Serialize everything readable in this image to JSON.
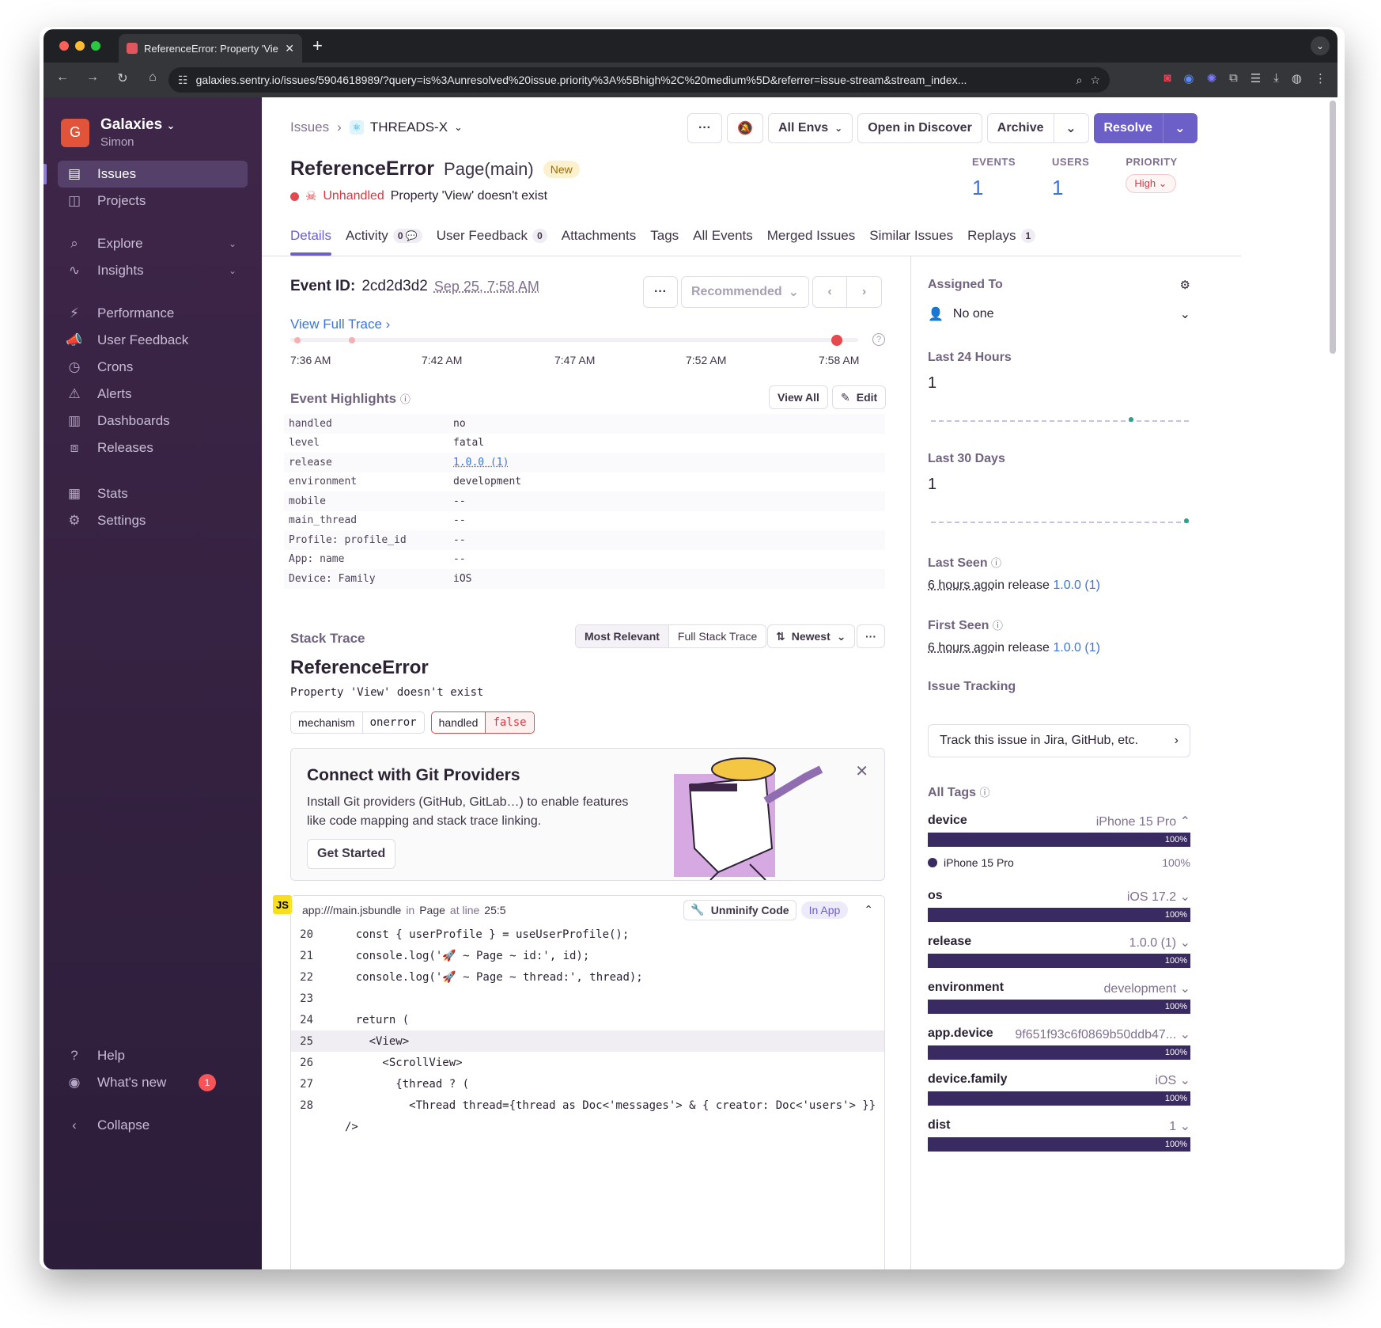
{
  "browser": {
    "tab_title": "ReferenceError: Property 'Vie",
    "url": "galaxies.sentry.io/issues/5904618989/?query=is%3Aunresolved%20issue.priority%3A%5Bhigh%2C%20medium%5D&referrer=issue-stream&stream_index..."
  },
  "sidebar": {
    "org_name": "Galaxies",
    "org_initial": "G",
    "user_name": "Simon",
    "items": [
      {
        "label": "Issues",
        "icon": "issues-icon"
      },
      {
        "label": "Projects",
        "icon": "projects-icon"
      },
      {
        "label": "Explore",
        "icon": "explore-icon"
      },
      {
        "label": "Insights",
        "icon": "insights-icon"
      },
      {
        "label": "Performance",
        "icon": "performance-icon"
      },
      {
        "label": "User Feedback",
        "icon": "feedback-icon"
      },
      {
        "label": "Crons",
        "icon": "crons-icon"
      },
      {
        "label": "Alerts",
        "icon": "alerts-icon"
      },
      {
        "label": "Dashboards",
        "icon": "dashboards-icon"
      },
      {
        "label": "Releases",
        "icon": "releases-icon"
      },
      {
        "label": "Stats",
        "icon": "stats-icon"
      },
      {
        "label": "Settings",
        "icon": "settings-icon"
      }
    ],
    "help": "Help",
    "whats_new": "What's new",
    "whats_new_count": "1",
    "collapse": "Collapse"
  },
  "header": {
    "breadcrumb_root": "Issues",
    "project": "THREADS-X",
    "env": "All Envs",
    "open_discover": "Open in Discover",
    "archive": "Archive",
    "resolve": "Resolve"
  },
  "issue": {
    "type": "ReferenceError",
    "location": "Page(main)",
    "badge": "New",
    "handled": "Unhandled",
    "message": "Property 'View' doesn't exist",
    "stats": {
      "events_label": "EVENTS",
      "events": "1",
      "users_label": "USERS",
      "users": "1",
      "priority_label": "PRIORITY",
      "priority": "High"
    }
  },
  "tabs": [
    {
      "label": "Details"
    },
    {
      "label": "Activity",
      "count": "0"
    },
    {
      "label": "User Feedback",
      "count": "0"
    },
    {
      "label": "Attachments"
    },
    {
      "label": "Tags"
    },
    {
      "label": "All Events"
    },
    {
      "label": "Merged Issues"
    },
    {
      "label": "Similar Issues"
    },
    {
      "label": "Replays",
      "count": "1"
    }
  ],
  "event": {
    "id_label": "Event ID:",
    "id": "2cd2d3d2",
    "date": "Sep 25, 7:58 AM",
    "recommended": "Recommended",
    "view_trace": "View Full Trace",
    "timeline": [
      "7:36 AM",
      "7:42 AM",
      "7:47 AM",
      "7:52 AM",
      "7:58 AM"
    ]
  },
  "highlights": {
    "title": "Event Highlights",
    "view_all": "View All",
    "edit": "Edit",
    "rows": [
      [
        "handled",
        "no"
      ],
      [
        "level",
        "fatal"
      ],
      [
        "release",
        "1.0.0 (1)"
      ],
      [
        "environment",
        "development"
      ],
      [
        "mobile",
        "--"
      ],
      [
        "main_thread",
        "--"
      ],
      [
        "Profile: profile_id",
        "--"
      ],
      [
        "App: name",
        "--"
      ],
      [
        "Device: Family",
        "iOS"
      ]
    ]
  },
  "stack": {
    "title": "Stack Trace",
    "most_relevant": "Most Relevant",
    "full": "Full Stack Trace",
    "newest": "Newest",
    "error_type": "ReferenceError",
    "error_msg": "Property 'View' doesn't exist",
    "chips": [
      [
        "mechanism",
        "onerror"
      ],
      [
        "handled",
        "false"
      ]
    ]
  },
  "git": {
    "title": "Connect with Git Providers",
    "body": "Install Git providers (GitHub, GitLab…) to enable features like code mapping and stack trace linking.",
    "cta": "Get Started"
  },
  "frame": {
    "js": "JS",
    "file": "app:///main.jsbundle",
    "in": "in",
    "func": "Page",
    "at": "at line",
    "line": "25:5",
    "unminify": "Unminify Code",
    "in_app": "In App"
  },
  "code": [
    {
      "n": "20",
      "t": "    const { userProfile } = useUserProfile();"
    },
    {
      "n": "21",
      "t": "    console.log('🚀 ~ Page ~ id:', id);"
    },
    {
      "n": "22",
      "t": "    console.log('🚀 ~ Page ~ thread:', thread);"
    },
    {
      "n": "23",
      "t": ""
    },
    {
      "n": "24",
      "t": "    return ("
    },
    {
      "n": "25",
      "t": "      <View>"
    },
    {
      "n": "26",
      "t": "        <ScrollView>"
    },
    {
      "n": "27",
      "t": "          {thread ? ("
    },
    {
      "n": "28",
      "t": "            <Thread thread={thread as Doc<'messages'> & { creator: Doc<'users'> }}"
    },
    {
      "n": "",
      "t": "/>"
    }
  ],
  "side": {
    "assigned_label": "Assigned To",
    "assigned": "No one",
    "last24_label": "Last 24 Hours",
    "last24": "1",
    "last30_label": "Last 30 Days",
    "last30": "1",
    "last_seen_label": "Last Seen",
    "last_seen": "6 hours ago",
    "first_seen_label": "First Seen",
    "first_seen": "6 hours ago",
    "in_release": "in release",
    "release": "1.0.0 (1)",
    "tracking_label": "Issue Tracking",
    "tracking": "Track this issue in Jira, GitHub, etc.",
    "tags_label": "All Tags",
    "tags": [
      {
        "k": "device",
        "v": "iPhone 15 Pro",
        "pct": "100%",
        "fraction": 1.0
      },
      {
        "k": "os",
        "v": "iOS 17.2",
        "pct": "100%",
        "fraction": 1.0
      },
      {
        "k": "release",
        "v": "1.0.0 (1)",
        "pct": "100%",
        "fraction": 1.0
      },
      {
        "k": "environment",
        "v": "development",
        "pct": "100%",
        "fraction": 1.0
      },
      {
        "k": "app.device",
        "v": "9f651f93c6f0869b50ddb47...",
        "pct": "100%",
        "fraction": 1.0
      },
      {
        "k": "device.family",
        "v": "iOS",
        "pct": "100%",
        "fraction": 1.0
      },
      {
        "k": "dist",
        "v": "1",
        "pct": "100%",
        "fraction": 1.0
      }
    ],
    "device_detail": "iPhone 15 Pro",
    "device_detail_pct": "100%"
  },
  "colors": {
    "accent": "#6c5fc7",
    "sidebar": "#3e2648",
    "error": "#e5484d",
    "link": "#3d74db"
  }
}
